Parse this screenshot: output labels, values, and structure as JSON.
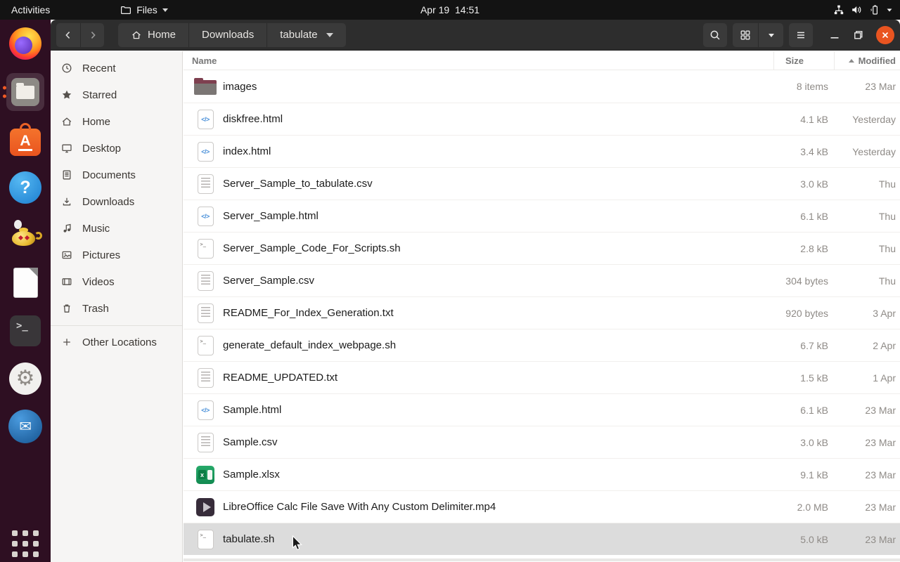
{
  "topbar": {
    "activities_label": "Activities",
    "app_menu_label": "Files",
    "clock": "Apr 19  14:51",
    "status_icons": [
      "network-icon",
      "volume-icon",
      "battery-icon",
      "caret-down-icon"
    ]
  },
  "window": {
    "titlebar": {
      "path": {
        "home": "Home",
        "downloads": "Downloads",
        "current": "tabulate"
      },
      "toolbar_icons": [
        "back-icon",
        "forward-icon",
        "search-icon",
        "grid-view-icon",
        "view-options-caret-icon",
        "hamburger-menu-icon"
      ],
      "window_controls": [
        "minimize-icon",
        "restore-icon",
        "close-icon"
      ]
    },
    "sidebar": {
      "items": [
        {
          "icon": "recent",
          "label": "Recent"
        },
        {
          "icon": "starred",
          "label": "Starred"
        },
        {
          "icon": "home",
          "label": "Home"
        },
        {
          "icon": "desktop",
          "label": "Desktop"
        },
        {
          "icon": "documents",
          "label": "Documents"
        },
        {
          "icon": "downloads",
          "label": "Downloads"
        },
        {
          "icon": "music",
          "label": "Music"
        },
        {
          "icon": "pictures",
          "label": "Pictures"
        },
        {
          "icon": "videos",
          "label": "Videos"
        },
        {
          "icon": "trash",
          "label": "Trash"
        }
      ],
      "other_locations": {
        "icon": "plus",
        "label": "Other Locations"
      }
    },
    "list": {
      "columns": {
        "name": "Name",
        "size": "Size",
        "modified": "Modified"
      },
      "sort_column": "Modified",
      "files": [
        {
          "icon": "folder",
          "name": "images",
          "size": "8 items",
          "modified": "23 Mar",
          "selected": false
        },
        {
          "icon": "html",
          "name": "diskfree.html",
          "size": "4.1 kB",
          "modified": "Yesterday",
          "selected": false
        },
        {
          "icon": "html",
          "name": "index.html",
          "size": "3.4 kB",
          "modified": "Yesterday",
          "selected": false
        },
        {
          "icon": "text",
          "name": "Server_Sample_to_tabulate.csv",
          "size": "3.0 kB",
          "modified": "Thu",
          "selected": false
        },
        {
          "icon": "html",
          "name": "Server_Sample.html",
          "size": "6.1 kB",
          "modified": "Thu",
          "selected": false
        },
        {
          "icon": "script",
          "name": "Server_Sample_Code_For_Scripts.sh",
          "size": "2.8 kB",
          "modified": "Thu",
          "selected": false
        },
        {
          "icon": "text",
          "name": "Server_Sample.csv",
          "size": "304 bytes",
          "modified": "Thu",
          "selected": false
        },
        {
          "icon": "text",
          "name": "README_For_Index_Generation.txt",
          "size": "920 bytes",
          "modified": "3 Apr",
          "selected": false
        },
        {
          "icon": "script",
          "name": "generate_default_index_webpage.sh",
          "size": "6.7 kB",
          "modified": "2 Apr",
          "selected": false
        },
        {
          "icon": "text",
          "name": "README_UPDATED.txt",
          "size": "1.5 kB",
          "modified": "1 Apr",
          "selected": false
        },
        {
          "icon": "html",
          "name": "Sample.html",
          "size": "6.1 kB",
          "modified": "23 Mar",
          "selected": false
        },
        {
          "icon": "text",
          "name": "Sample.csv",
          "size": "3.0 kB",
          "modified": "23 Mar",
          "selected": false
        },
        {
          "icon": "xlsx",
          "name": "Sample.xlsx",
          "size": "9.1 kB",
          "modified": "23 Mar",
          "selected": false
        },
        {
          "icon": "video",
          "name": "LibreOffice Calc File Save With Any Custom Delimiter.mp4",
          "size": "2.0 MB",
          "modified": "23 Mar",
          "selected": false
        },
        {
          "icon": "script",
          "name": "tabulate.sh",
          "size": "5.0 kB",
          "modified": "23 Mar",
          "selected": true
        }
      ]
    }
  },
  "dock": {
    "items": [
      {
        "name": "firefox"
      },
      {
        "name": "files",
        "active": true,
        "indicator_dots": 2
      },
      {
        "name": "ubuntu-software"
      },
      {
        "name": "help"
      },
      {
        "name": "lamp"
      },
      {
        "name": "libreoffice"
      },
      {
        "name": "terminal"
      },
      {
        "name": "settings"
      },
      {
        "name": "thunderbird"
      },
      {
        "name": "app-grid"
      }
    ]
  },
  "colors": {
    "accent_orange": "#e95420",
    "selection_grey": "#dcdcdc",
    "titlebar": "#2d2d2d",
    "dock": "#2e0f22",
    "xlsx_green": "#21a366"
  }
}
